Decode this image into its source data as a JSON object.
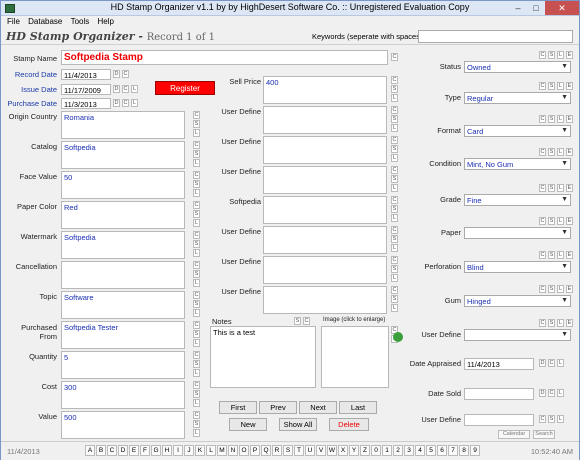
{
  "window": {
    "title": "HD Stamp Organizer v1.1 by by HighDesert Software Co. :: Unregistered Evaluation Copy",
    "minimize": "–",
    "maximize": "□",
    "close": "✕"
  },
  "menu": [
    "File",
    "Database",
    "Tools",
    "Help"
  ],
  "header": {
    "app_name": "HD Stamp Organizer -",
    "record": "Record 1 of 1",
    "keywords_label": "Keywords (seperate with spaces)",
    "keywords_value": ""
  },
  "left": {
    "stamp_name": {
      "label": "Stamp Name",
      "value": "Softpedia Stamp"
    },
    "record_date": {
      "label": "Record Date",
      "value": "11/4/2013"
    },
    "issue_date": {
      "label": "Issue Date",
      "value": "11/17/2009"
    },
    "purchase_date": {
      "label": "Purchase Date",
      "value": "11/3/2013"
    },
    "register_button": "Register",
    "fields": [
      {
        "label": "Origin Country",
        "value": "Romania"
      },
      {
        "label": "Catalog",
        "value": "Softpedia"
      },
      {
        "label": "Face Value",
        "value": "50"
      },
      {
        "label": "Paper Color",
        "value": "Red"
      },
      {
        "label": "Watermark",
        "value": "Softpedia"
      },
      {
        "label": "Cancellation",
        "value": ""
      },
      {
        "label": "Topic",
        "value": "Software"
      },
      {
        "label": "Purchased From",
        "value": "Softpedia Tester"
      },
      {
        "label": "Quantity",
        "value": "5"
      },
      {
        "label": "Cost",
        "value": "300"
      },
      {
        "label": "Value",
        "value": "500"
      }
    ]
  },
  "middle": {
    "fields": [
      {
        "label": "Sell Price",
        "value": "400"
      },
      {
        "label": "User Define",
        "value": ""
      },
      {
        "label": "User Define",
        "value": ""
      },
      {
        "label": "User Define",
        "value": ""
      },
      {
        "label": "Softpedia",
        "value": ""
      },
      {
        "label": "User Define",
        "value": ""
      },
      {
        "label": "User Define",
        "value": ""
      },
      {
        "label": "User Define",
        "value": ""
      }
    ],
    "notes_label": "Notes",
    "notes_value": "This is a test",
    "image_label": "Image (click to enlarge)"
  },
  "nav": {
    "first": "First",
    "prev": "Prev",
    "next": "Next",
    "last": "Last",
    "new": "New",
    "show_all": "Show All",
    "delete": "Delete"
  },
  "right": {
    "selects": [
      {
        "label": "Status",
        "value": "Owned"
      },
      {
        "label": "Type",
        "value": "Regular"
      },
      {
        "label": "Format",
        "value": "Card"
      },
      {
        "label": "Condition",
        "value": "Mint, No Gum"
      },
      {
        "label": "Grade",
        "value": "Fine"
      },
      {
        "label": "Paper",
        "value": ""
      },
      {
        "label": "Perforation",
        "value": "Blind"
      },
      {
        "label": "Gum",
        "value": "Hinged"
      },
      {
        "label": "User Define",
        "value": ""
      }
    ],
    "date_appraised": {
      "label": "Date Appraised",
      "value": "11/4/2013"
    },
    "date_sold": {
      "label": "Date Sold",
      "value": ""
    },
    "user_define": {
      "label": "User Define",
      "value": ""
    },
    "calendar_button": "Calendar",
    "search_button": "Search"
  },
  "status_bar": {
    "date": "11/4/2013",
    "time": "10:52:40 AM",
    "alphabet": [
      "A",
      "B",
      "C",
      "D",
      "E",
      "F",
      "G",
      "H",
      "I",
      "J",
      "K",
      "L",
      "M",
      "N",
      "O",
      "P",
      "Q",
      "R",
      "S",
      "T",
      "U",
      "V",
      "W",
      "X",
      "Y",
      "Z",
      "0",
      "1",
      "2",
      "3",
      "4",
      "5",
      "6",
      "7",
      "8",
      "9"
    ]
  },
  "mini_buttons": {
    "c": "C",
    "s": "S",
    "l": "L",
    "e": "E",
    "d": "D"
  }
}
